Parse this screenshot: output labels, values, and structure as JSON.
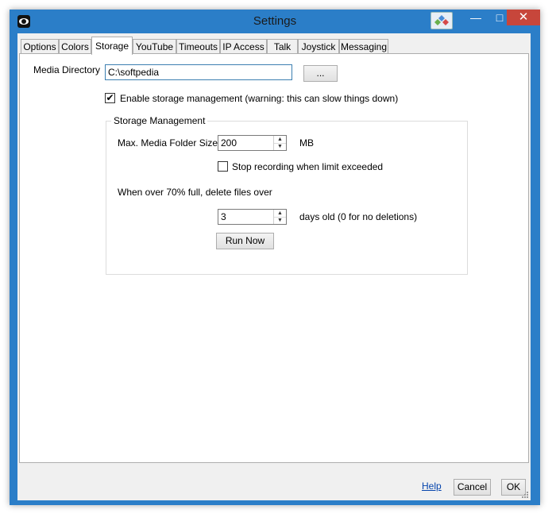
{
  "window": {
    "title": "Settings"
  },
  "tabs": [
    {
      "label": "Options"
    },
    {
      "label": "Colors"
    },
    {
      "label": "Storage"
    },
    {
      "label": "YouTube"
    },
    {
      "label": "Timeouts"
    },
    {
      "label": "IP Access"
    },
    {
      "label": "Talk"
    },
    {
      "label": "Joystick"
    },
    {
      "label": "Messaging"
    }
  ],
  "storage": {
    "media_directory_label": "Media Directory",
    "media_directory_value": "C:\\softpedia",
    "browse_label": "...",
    "enable_label": "Enable storage management (warning: this can slow things down)",
    "enable_checked": "✔",
    "group_title": "Storage Management",
    "max_size_label": "Max. Media Folder Size",
    "max_size_value": "200",
    "max_size_unit": "MB",
    "stop_label": "Stop recording when limit exceeded",
    "over_label": "When over 70% full, delete files over",
    "days_value": "3",
    "days_label": "days old (0 for no deletions)",
    "run_label": "Run Now"
  },
  "footer": {
    "help_label": "Help",
    "cancel_label": "Cancel",
    "ok_label": "OK"
  },
  "icons": {
    "minimize": "minimize-icon",
    "maximize": "maximize-icon",
    "close": "close-icon"
  }
}
